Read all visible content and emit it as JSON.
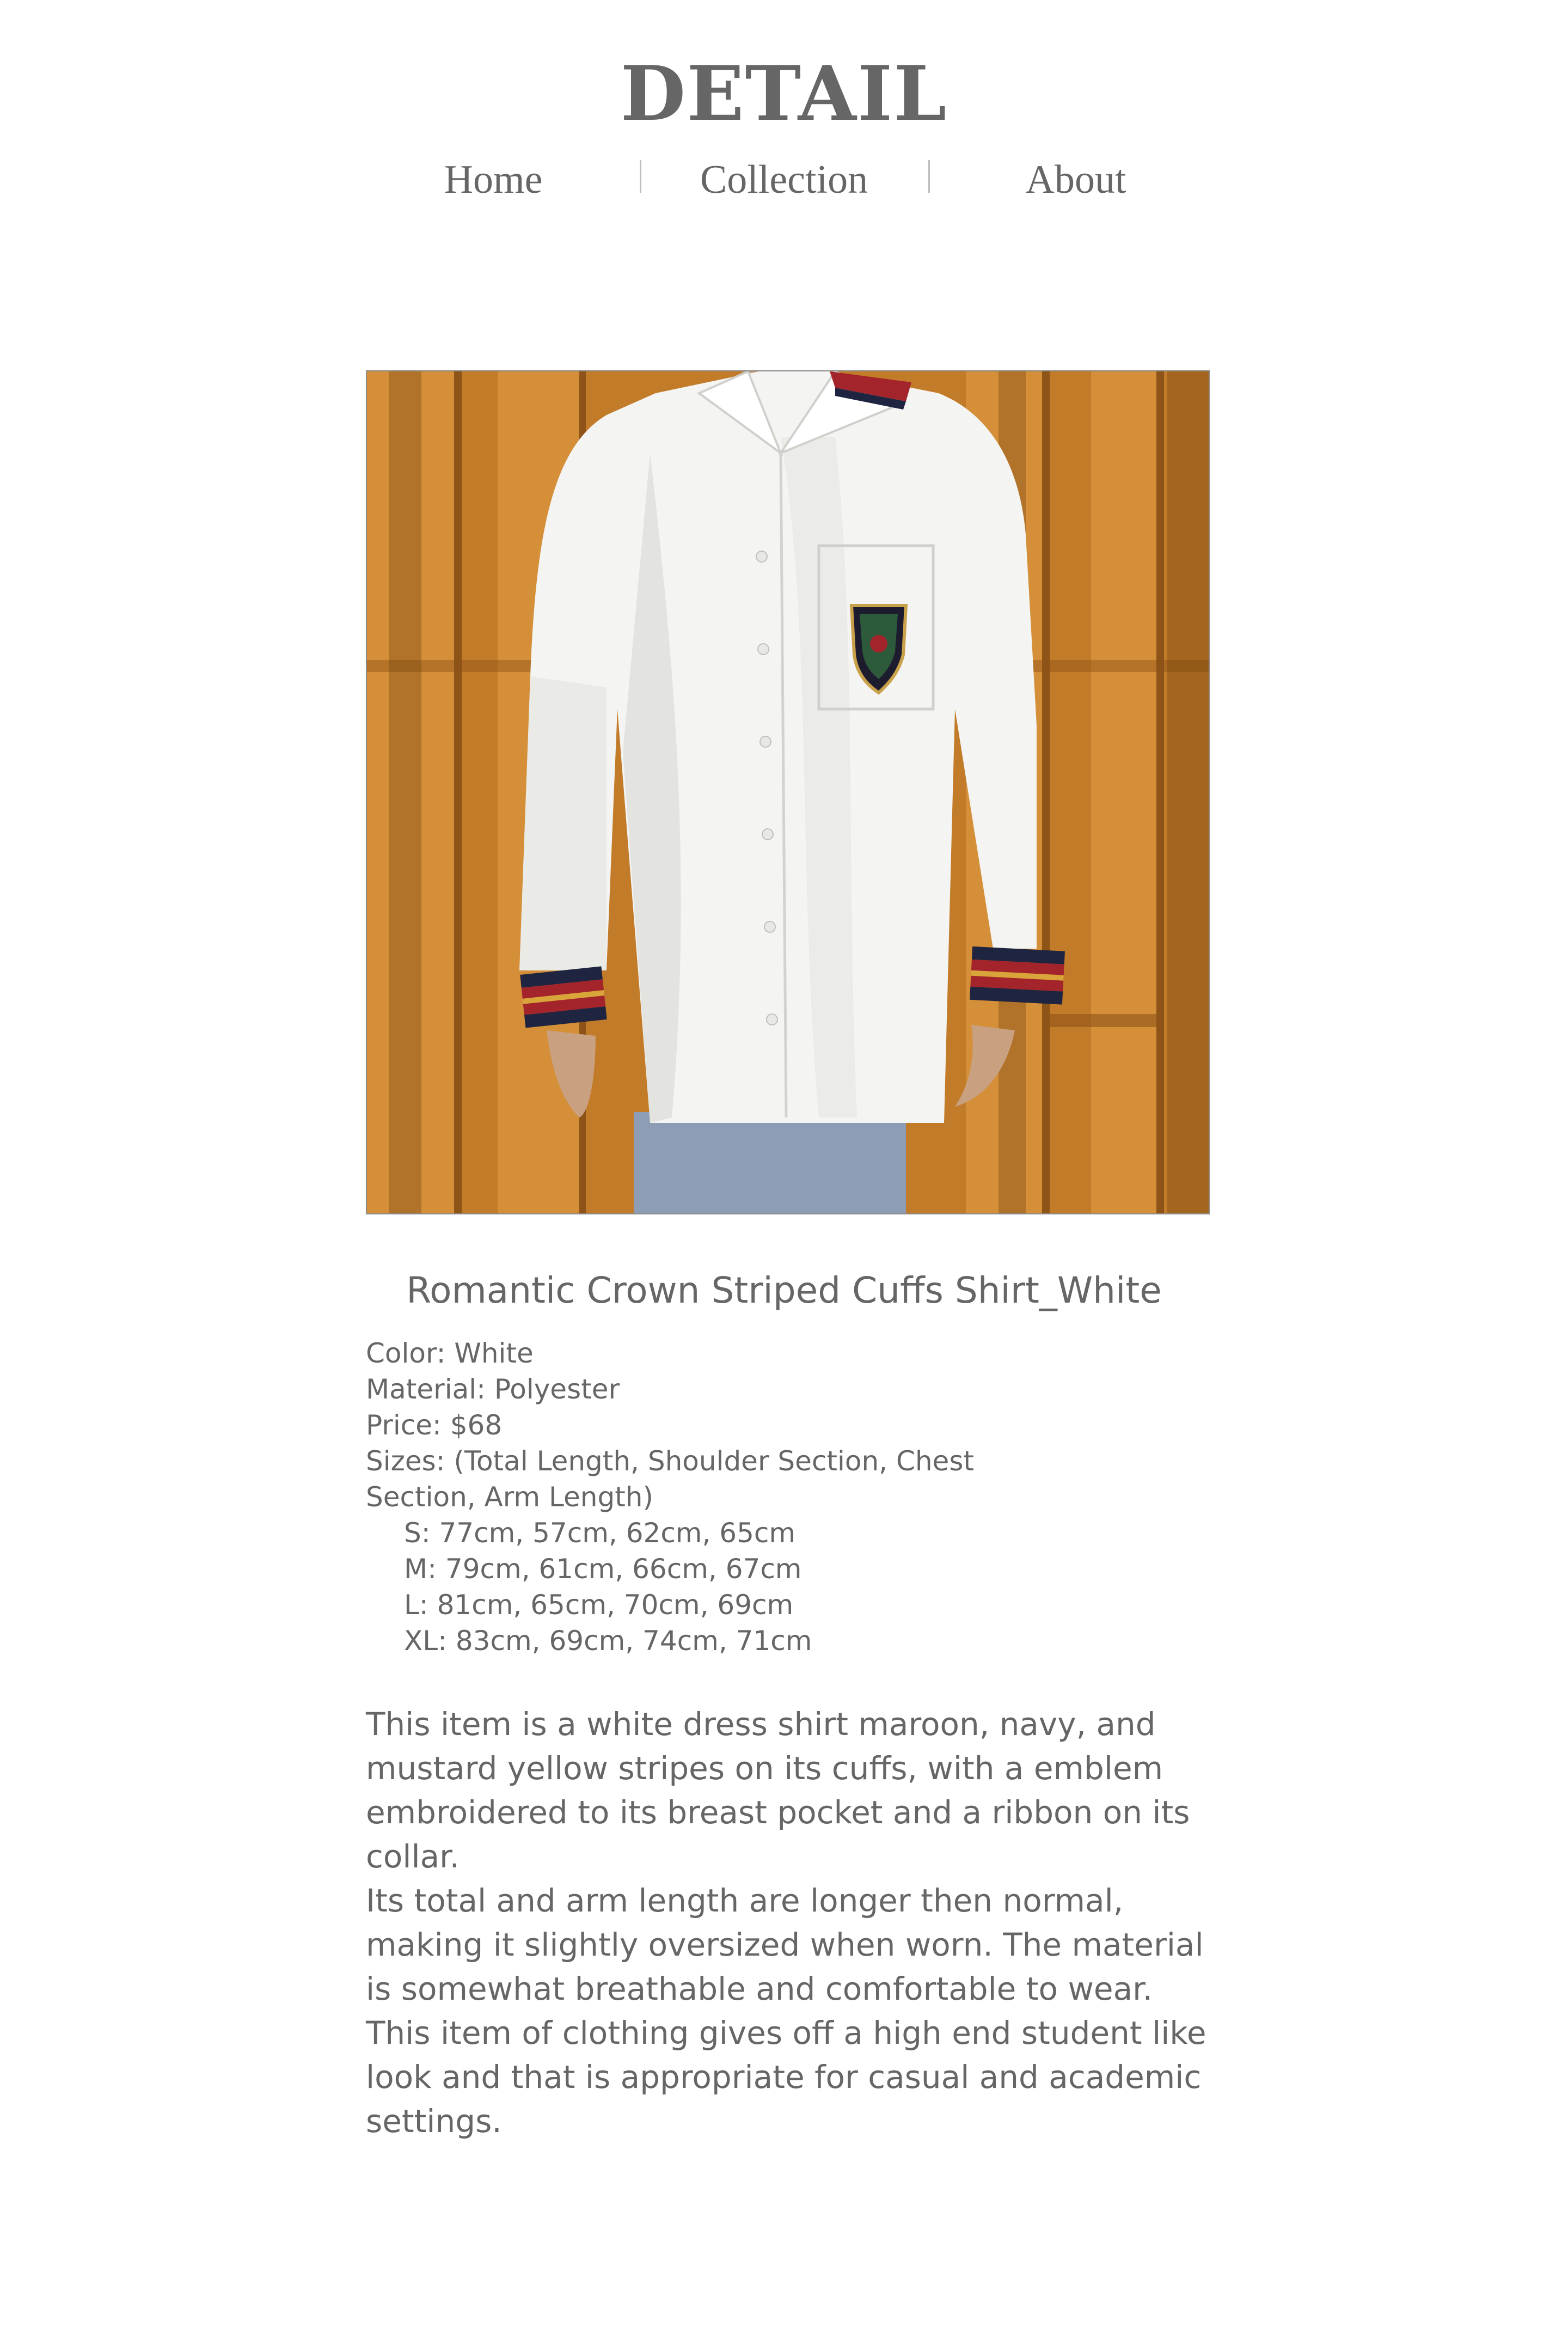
{
  "header": {
    "title": "DETAIL",
    "nav": [
      "Home",
      "Collection",
      "About"
    ]
  },
  "product": {
    "image_alt": "White dress shirt with striped cuffs and embroidered pocket emblem",
    "title": "Romantic Crown Striped Cuffs Shirt_White",
    "specs": [
      "Color: White",
      "Material: Polyester",
      "Price: $68",
      "Sizes: (Total Length, Shoulder Section, Chest Section, Arm Length)"
    ],
    "sizes": [
      "S: 77cm, 57cm, 62cm, 65cm",
      "M: 79cm, 61cm, 66cm, 67cm",
      "L: 81cm, 65cm, 70cm, 69cm",
      "XL: 83cm, 69cm, 74cm, 71cm"
    ],
    "description": [
      "This item is a white dress shirt maroon, navy, and mustard yellow stripes on its cuffs, with a emblem embroidered to its breast pocket and a ribbon on its collar.",
      "Its total and arm length are longer then normal, making it slightly oversized when worn. The material is somewhat breathable and comfortable to wear.",
      "This item of clothing gives off a high end student like look and that is appropriate for casual and academic settings."
    ]
  },
  "colors": {
    "text": "#666666",
    "background": "#ffffff",
    "fence": "#c9832c",
    "shirt": "#f4f4f2",
    "stripe_maroon": "#a3242a",
    "stripe_navy": "#1f2440",
    "stripe_mustard": "#d9a43a"
  }
}
